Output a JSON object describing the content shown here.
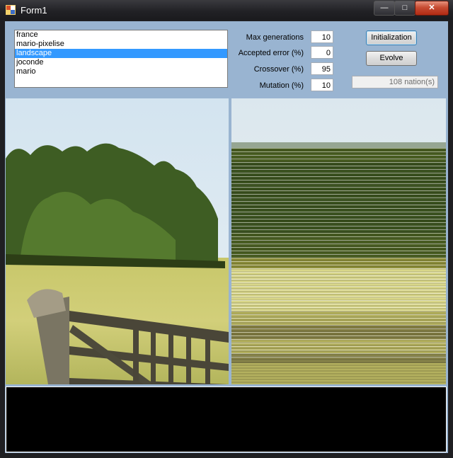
{
  "window": {
    "title": "Form1"
  },
  "controls": {
    "minimize": "—",
    "maximize": "□",
    "close": "✕"
  },
  "list": {
    "items": [
      "france",
      "mario-pixelise",
      "landscape",
      "joconde",
      "mario"
    ],
    "selected_index": 2
  },
  "params": [
    {
      "label": "Max generations",
      "value": "10"
    },
    {
      "label": "Accepted error (%)",
      "value": "0"
    },
    {
      "label": "Crossover (%)",
      "value": "95"
    },
    {
      "label": "Mutation (%)",
      "value": "10"
    }
  ],
  "buttons": {
    "init_label": "Initialization",
    "evolve_label": "Evolve"
  },
  "status": {
    "text": "108 nation(s)"
  },
  "console": {
    "text": ""
  }
}
